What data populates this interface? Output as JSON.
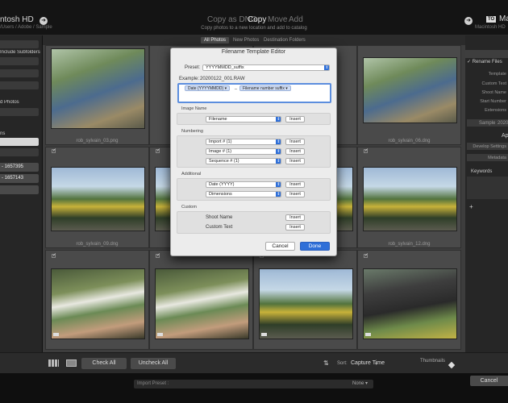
{
  "source": {
    "name": "ntosh HD",
    "path": "/Users / Adobe / Sample"
  },
  "modes": {
    "copy_as_dng": "Copy as DNG",
    "copy": "Copy",
    "move": "Move",
    "add": "Add",
    "description": "Copy photos to a new location and add to catalog"
  },
  "destination": {
    "to_label": "TO",
    "name": "Ma",
    "path": "Macintosh HD"
  },
  "left_panel": {
    "include_subfolders": "Include Subfolders",
    "photos_label": "d Photos",
    "items_label": "ns",
    "devices": [
      "- 1657395",
      "- 1657143"
    ]
  },
  "filters": {
    "all": "All Photos",
    "new": "New Photos",
    "dest": "Destination Folders"
  },
  "grid": {
    "captions": [
      "rob_sylvain_03.png",
      "rob_sylvain_06.dng",
      "rob_sylvain_09.dng",
      "rob_sylvain_12.dng"
    ]
  },
  "right_panel": {
    "rename_files": "Rename Files",
    "template": "Template",
    "custom_text": "Custom Text",
    "shoot_name": "Shoot Name",
    "start_number": "Start Number",
    "extensions": "Extensions",
    "sample_label": "Sample",
    "sample_value": "2020",
    "apply_heading": "Ap",
    "develop_settings": "Develop Settings",
    "metadata": "Metadata",
    "keywords": "Keywords",
    "plus": "+"
  },
  "toolbar": {
    "check_all": "Check All",
    "uncheck_all": "Uncheck All",
    "sort_label": "Sort:",
    "sort_value": "Capture Time",
    "thumbnails": "Thumbnails"
  },
  "bottom": {
    "import_preset_label": "Import Preset :",
    "import_preset_value": "None",
    "cancel": "Cancel"
  },
  "dialog": {
    "title": "Filename Template Editor",
    "preset_label": "Preset:",
    "preset_value": "YYYYMMDD_suffix",
    "example_label": "Example:",
    "example_value": "20200122_001.RAW",
    "tokens": [
      "Date (YYYYMMDD)",
      "_",
      "Filename number suffix"
    ],
    "image_name": {
      "title": "Image Name",
      "popup": "Filename",
      "insert": "Insert"
    },
    "numbering": {
      "title": "Numbering",
      "popups": [
        "Import # (1)",
        "Image # (1)",
        "Sequence # (1)"
      ],
      "insert": "Insert"
    },
    "additional": {
      "title": "Additional",
      "popups": [
        "Date (YYYY)",
        "Dimensions"
      ],
      "insert": "Insert"
    },
    "custom": {
      "title": "Custom",
      "shoot_name": "Shoot Name",
      "custom_text": "Custom Text",
      "insert": "Insert"
    },
    "cancel": "Cancel",
    "done": "Done"
  }
}
